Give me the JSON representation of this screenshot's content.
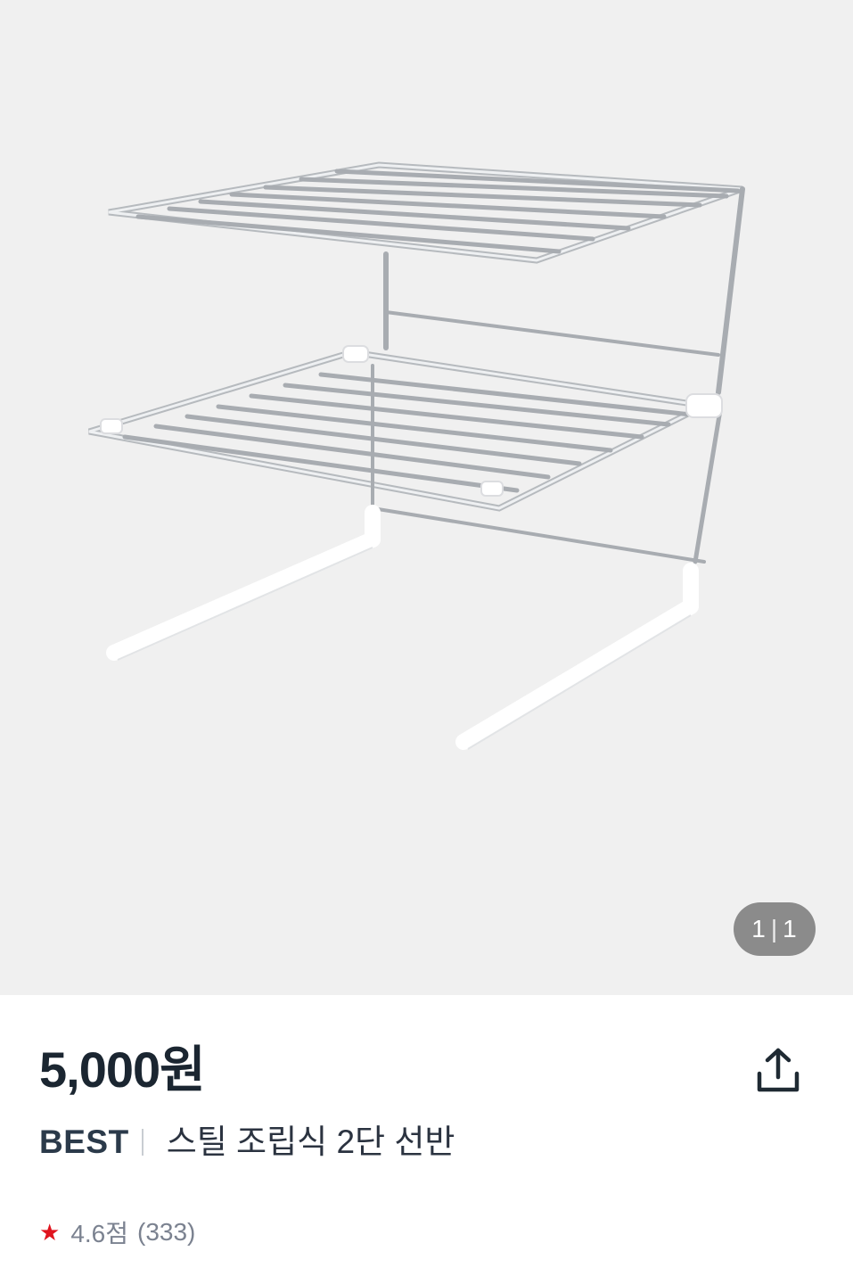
{
  "image": {
    "alt_subject": "steel-rack-photo",
    "page_current": "1",
    "page_total": "1"
  },
  "product": {
    "price": "5,000원",
    "badge": "BEST",
    "name": "스틸 조립식 2단 선반",
    "rating": "4.6점",
    "review_count": "(333)"
  },
  "icons": {
    "share": "share-icon",
    "star": "star-icon"
  },
  "colors": {
    "price_text": "#1b2631",
    "star": "#e0141e",
    "indicator_bg": "#6e6e6e",
    "image_bg": "#f0f0f0"
  }
}
